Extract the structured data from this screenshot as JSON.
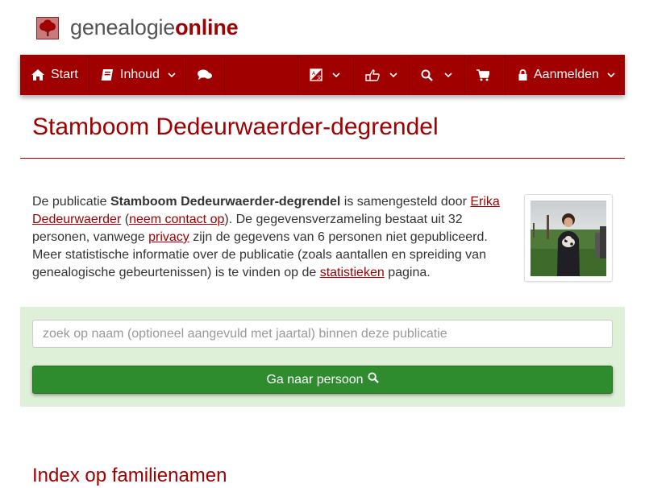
{
  "brand": {
    "name_part1": "genealogie",
    "name_part2": "online",
    "logo_icon": "tree-icon"
  },
  "navbar": {
    "start_label": "Start",
    "content_label": "Inhoud",
    "login_label": "Aanmelden",
    "icons": {
      "home": "home-icon",
      "book": "book-icon",
      "chat": "comments-icon",
      "language": "language-icon",
      "share": "share-icon",
      "search": "search-icon",
      "cart": "cart-icon",
      "lock": "lock-icon",
      "chevron": "chevron-down-icon"
    }
  },
  "page": {
    "title": "Stamboom Dedeurwaerder-degrendel",
    "intro": {
      "part1": "De publicatie ",
      "pub_name": "Stamboom Dedeurwaerder-degrendel",
      "part2": " is samengesteld door ",
      "author": "Erika Dedeurwaerder",
      "part3": " (",
      "contact": "neem contact op",
      "part4": "). De gegevensverzameling bestaat uit 32 personen, vanwege ",
      "privacy": "privacy",
      "part5": " zijn de gegevens van 6 personen niet gepubliceerd. Meer statistische informatie over de publicatie (zoals aantallen en spreiding van genealogische gebeurtenissen) is te vinden op de ",
      "stats": "statistieken",
      "part6": " pagina."
    }
  },
  "search": {
    "placeholder": "zoek op naam (optioneel aangevuld met jaartal) binnen deze publicatie",
    "value": "",
    "button_label": "Ga naar persoon"
  },
  "index_heading": "Index op familienamen",
  "colors": {
    "brand_red": "#a00000",
    "panel_green": "#dff0d8",
    "button_green": "#2e8b2e"
  }
}
